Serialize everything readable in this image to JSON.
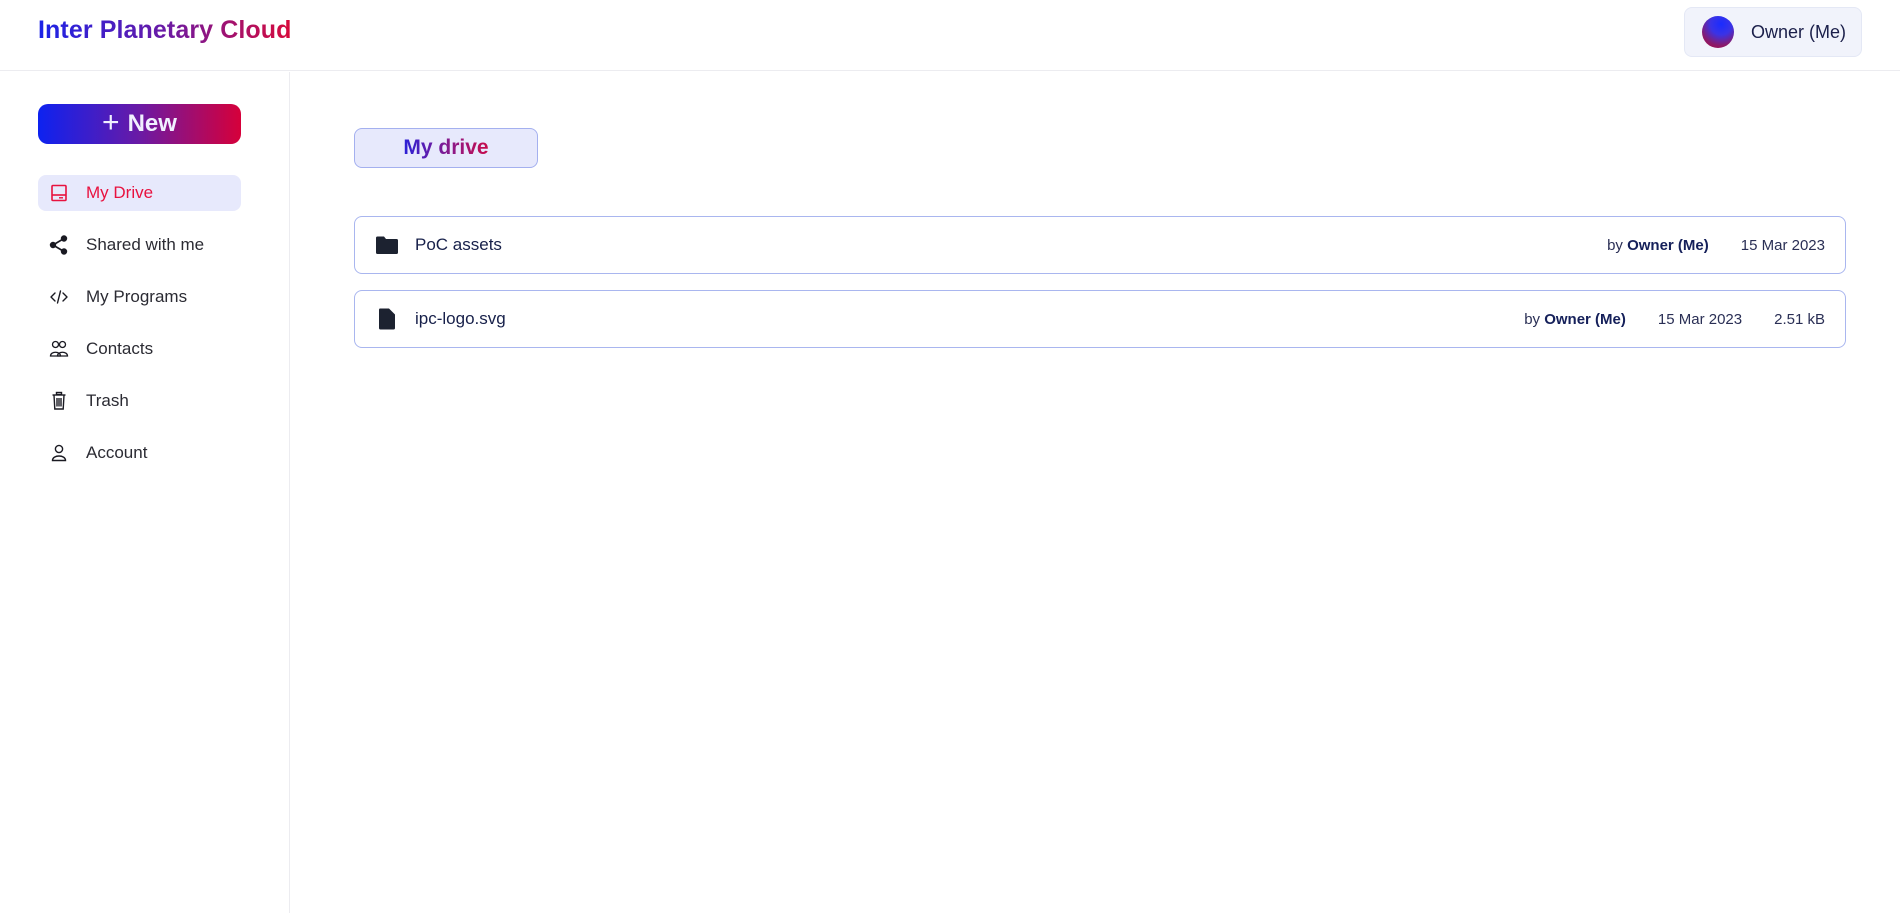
{
  "app": {
    "title": "Inter Planetary Cloud"
  },
  "header": {
    "user_name": "Owner (Me)"
  },
  "sidebar": {
    "new_button": {
      "icon": "plus-icon",
      "label": "New"
    },
    "items": [
      {
        "label": "My Drive",
        "icon": "drive-icon",
        "active": true
      },
      {
        "label": "Shared with me",
        "icon": "share-icon",
        "active": false
      },
      {
        "label": "My Programs",
        "icon": "code-icon",
        "active": false
      },
      {
        "label": "Contacts",
        "icon": "contacts-icon",
        "active": false
      },
      {
        "label": "Trash",
        "icon": "trash-icon",
        "active": false
      },
      {
        "label": "Account",
        "icon": "user-icon",
        "active": false
      }
    ]
  },
  "main": {
    "breadcrumb": "My drive",
    "files": [
      {
        "type": "folder",
        "icon": "folder-icon",
        "name": "PoC assets",
        "by_prefix": "by",
        "owner": "Owner (Me)",
        "date": "15 Mar 2023",
        "size": null
      },
      {
        "type": "file",
        "icon": "file-icon",
        "name": "ipc-logo.svg",
        "by_prefix": "by",
        "owner": "Owner (Me)",
        "date": "15 Mar 2023",
        "size": "2.51 kB"
      }
    ]
  },
  "colors": {
    "brand_start": "#1a23e8",
    "brand_end": "#d80a3a",
    "active_nav_bg": "#e7e9fc",
    "active_nav_text": "#e8123f",
    "row_border": "#a9b6ef"
  }
}
